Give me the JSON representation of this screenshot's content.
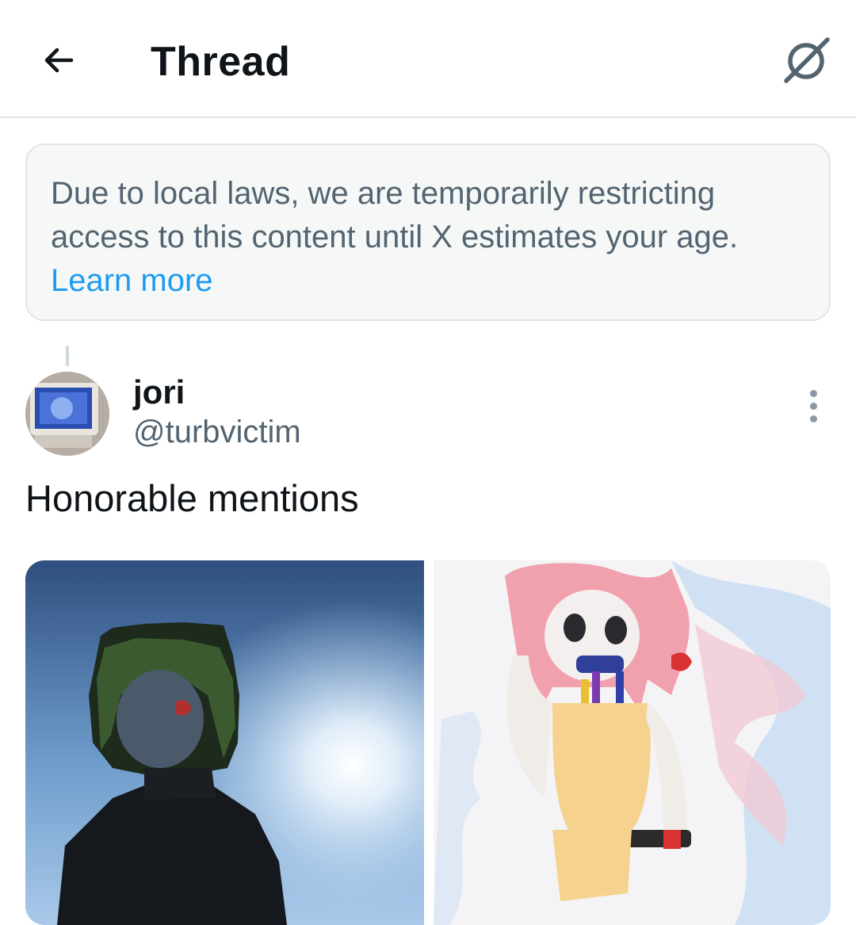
{
  "header": {
    "title": "Thread",
    "back_icon": "arrow-left-icon",
    "grok_icon": "grok-icon"
  },
  "notice": {
    "message": "Due to local laws, we are temporarily restricting access to this content until X estimates your age.",
    "link_label": "Learn more",
    "link_color": "#1d9bf0"
  },
  "tweet": {
    "author_name": "jori",
    "author_handle": "@turbvictim",
    "text": "Honorable mentions",
    "more_icon": "more-dots-icon",
    "media": [
      {
        "name": "media-photo-1",
        "kind": "photo"
      },
      {
        "name": "media-photo-2",
        "kind": "illustration"
      }
    ]
  },
  "colors": {
    "text_primary": "#0f1419",
    "text_secondary": "#536471",
    "accent": "#1d9bf0",
    "notice_bg": "#f6f8f8"
  }
}
